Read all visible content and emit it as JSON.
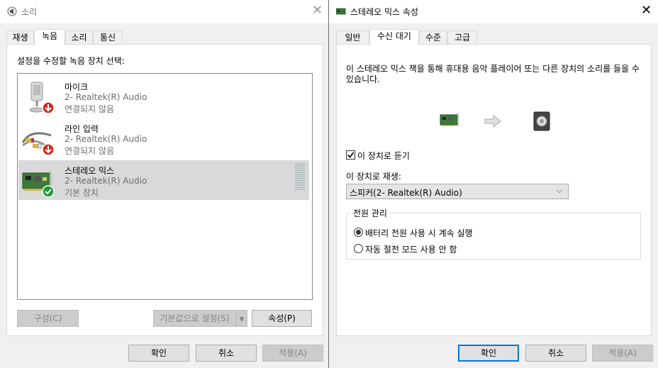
{
  "left_dialog": {
    "title": "소리",
    "tabs": [
      {
        "label": "재생"
      },
      {
        "label": "녹음"
      },
      {
        "label": "소리"
      },
      {
        "label": "통신"
      }
    ],
    "instruction": "설정을 수정할 녹음 장치 선택:",
    "devices": [
      {
        "name": "마이크",
        "driver": "2- Realtek(R) Audio",
        "status": "연결되지 않음"
      },
      {
        "name": "라인 입력",
        "driver": "2- Realtek(R) Audio",
        "status": "연결되지 않음"
      },
      {
        "name": "스테레오 믹스",
        "driver": "2- Realtek(R) Audio",
        "status": "기본 장치"
      }
    ],
    "buttons": {
      "configure": "구성(C)",
      "set_default": "기본값으로 설정(S)",
      "properties": "속성(P)",
      "ok": "확인",
      "cancel": "취소",
      "apply": "적용(A)"
    }
  },
  "right_dialog": {
    "title": "스테레오 믹스 속성",
    "tabs": [
      {
        "label": "일반"
      },
      {
        "label": "수신 대기"
      },
      {
        "label": "수준"
      },
      {
        "label": "고급"
      }
    ],
    "description": "이 스테레오 믹스 잭을 통해 휴대용 음악 플레이어 또는 다른 장치의 소리를 들을 수 있습니다.",
    "listen_checkbox": {
      "label": "이 장치로 듣기",
      "checked": true
    },
    "playback_label": "이 장치로 재생:",
    "playback_select": "스피커(2- Realtek(R) Audio)",
    "power_group": {
      "title": "전원 관리",
      "options": [
        {
          "label": "배터리 전원 사용 시 계속 실행",
          "checked": true
        },
        {
          "label": "자동 절전 모드 사용 안 함",
          "checked": false
        }
      ]
    },
    "buttons": {
      "ok": "확인",
      "cancel": "취소",
      "apply": "적용(A)"
    }
  },
  "colors": {
    "accent": "#0078d7",
    "selected_row": "#d9d9d9",
    "check_green": "#1a9b3a",
    "down_red": "#d9261c",
    "dialog_bg": "#f0f0f0"
  }
}
